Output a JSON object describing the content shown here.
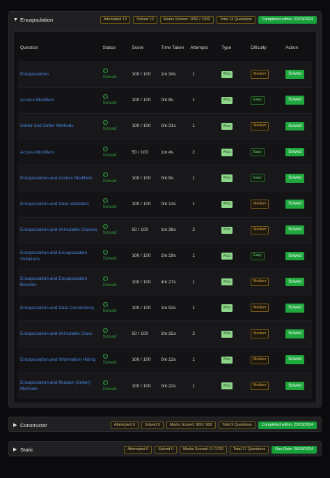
{
  "sections": [
    {
      "title": "Encapsulation",
      "expanded": true,
      "badges": [
        "Attempted 13",
        "Solved 13",
        "Marks Scored: 1150 / 1300",
        "Total 13 Questions"
      ],
      "status_badge": "Completed within: 22/03/2024"
    },
    {
      "title": "Constructor",
      "expanded": false,
      "badges": [
        "Attempted 9",
        "Solved 9",
        "Marks Scored: 900 / 900",
        "Total 9 Questions"
      ],
      "status_badge": "Completed within: 22/03/2024"
    },
    {
      "title": "Static",
      "expanded": false,
      "badges": [
        "Attempted 0",
        "Solved 0",
        "Marks Scored: 0 / 1700",
        "Total 17 Questions"
      ],
      "status_badge": "Due Date: 26/03/2024"
    }
  ],
  "columns": [
    "Question",
    "Status",
    "Score",
    "Time Taken",
    "Attempts",
    "Type",
    "Dificulty",
    "Action"
  ],
  "rows": [
    {
      "question": "Encapsulation",
      "status": "Solved",
      "score": "100 / 100",
      "time": "1m:34s",
      "attempts": "1",
      "type": "Mcq",
      "difficulty": "Medium",
      "action": "Solved"
    },
    {
      "question": "Access Modifiers",
      "status": "Solved",
      "score": "100 / 100",
      "time": "0m:8s",
      "attempts": "1",
      "type": "Mcq",
      "difficulty": "Easy",
      "action": "Solved"
    },
    {
      "question": "Getter and Setter Methods",
      "status": "Solved",
      "score": "100 / 100",
      "time": "0m:31s",
      "attempts": "1",
      "type": "Mcq",
      "difficulty": "Medium",
      "action": "Solved"
    },
    {
      "question": "Access Modifiers",
      "status": "Solved",
      "score": "50 / 100",
      "time": "1m:4s",
      "attempts": "2",
      "type": "Mcq",
      "difficulty": "Easy",
      "action": "Solved"
    },
    {
      "question": "Encapsulation and Access Modifiers",
      "status": "Solved",
      "score": "100 / 100",
      "time": "0m:9s",
      "attempts": "1",
      "type": "Mcq",
      "difficulty": "Easy",
      "action": "Solved"
    },
    {
      "question": "Encapsulation and Data Validation",
      "status": "Solved",
      "score": "100 / 100",
      "time": "0m:14s",
      "attempts": "1",
      "type": "Mcq",
      "difficulty": "Medium",
      "action": "Solved"
    },
    {
      "question": "Encapsulation and Immutable Classes",
      "status": "Solved",
      "score": "50 / 100",
      "time": "1m:36s",
      "attempts": "2",
      "type": "Mcq",
      "difficulty": "Medium",
      "action": "Solved"
    },
    {
      "question": "Encapsulation and Encapsulation Violations",
      "status": "Solved",
      "score": "100 / 100",
      "time": "2m:19s",
      "attempts": "1",
      "type": "Mcq",
      "difficulty": "Easy",
      "action": "Solved"
    },
    {
      "question": "Encapsulation and Encapsulation Benefits",
      "status": "Solved",
      "score": "100 / 100",
      "time": "4m:27s",
      "attempts": "1",
      "type": "Mcq",
      "difficulty": "Medium",
      "action": "Solved"
    },
    {
      "question": "Encapsulation and Data Consistency",
      "status": "Solved",
      "score": "100 / 100",
      "time": "1m:53s",
      "attempts": "1",
      "type": "Mcq",
      "difficulty": "Medium",
      "action": "Solved"
    },
    {
      "question": "Encapsulation and Immutable Class",
      "status": "Solved",
      "score": "50 / 100",
      "time": "2m:15s",
      "attempts": "2",
      "type": "Mcq",
      "difficulty": "Medium",
      "action": "Solved"
    },
    {
      "question": "Encapsulation and Information Hiding",
      "status": "Solved",
      "score": "100 / 100",
      "time": "0m:13s",
      "attempts": "1",
      "type": "Mcq",
      "difficulty": "Medium",
      "action": "Solved"
    },
    {
      "question": "Encapsulation and Mutator (Setter) Methods",
      "status": "Solved",
      "score": "100 / 100",
      "time": "0m:22s",
      "attempts": "1",
      "type": "Mcq",
      "difficulty": "Medium",
      "action": "Solved"
    }
  ],
  "colors": {
    "accent_green": "#1fa83d",
    "link_blue": "#4a85e0",
    "badge_gold": "#d8c27a",
    "mcq_green": "#8ed68a"
  },
  "icons": {
    "expanded": "caret-down-icon",
    "collapsed": "caret-right-icon",
    "status": "check-circle-icon"
  }
}
